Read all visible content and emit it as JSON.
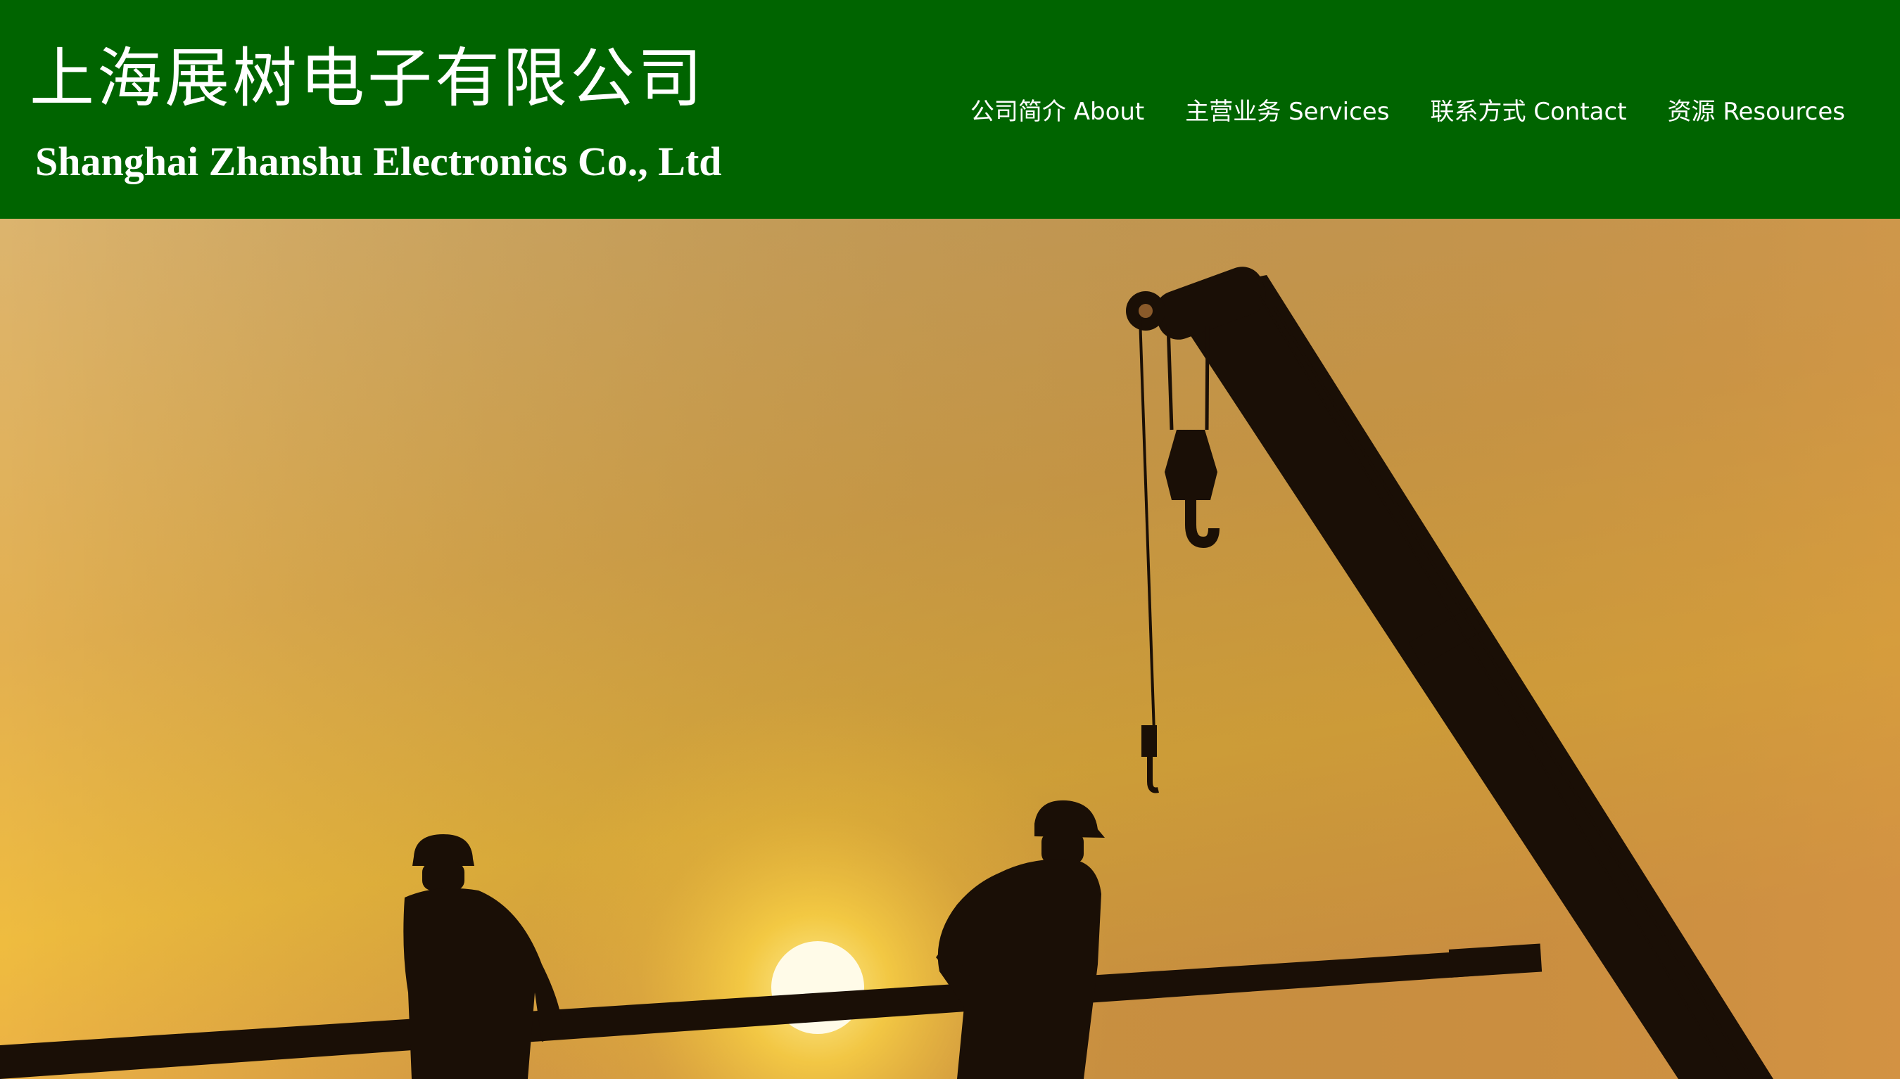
{
  "header": {
    "title_cn": "上海展树电子有限公司",
    "title_en": "Shanghai Zhanshu Electronics Co., Ltd",
    "background_color": "#006400"
  },
  "nav": {
    "items": [
      {
        "label": "公司简介 About"
      },
      {
        "label": "主营业务 Services"
      },
      {
        "label": "联系方式 Contact"
      },
      {
        "label": "资源 Resources"
      }
    ]
  },
  "hero": {
    "scene": "sunset-construction-silhouette",
    "sky_colors": [
      "#dcb36b",
      "#e6b24a",
      "#f2c23c",
      "#d69a3c"
    ],
    "sun_color": "#fffbe8"
  }
}
